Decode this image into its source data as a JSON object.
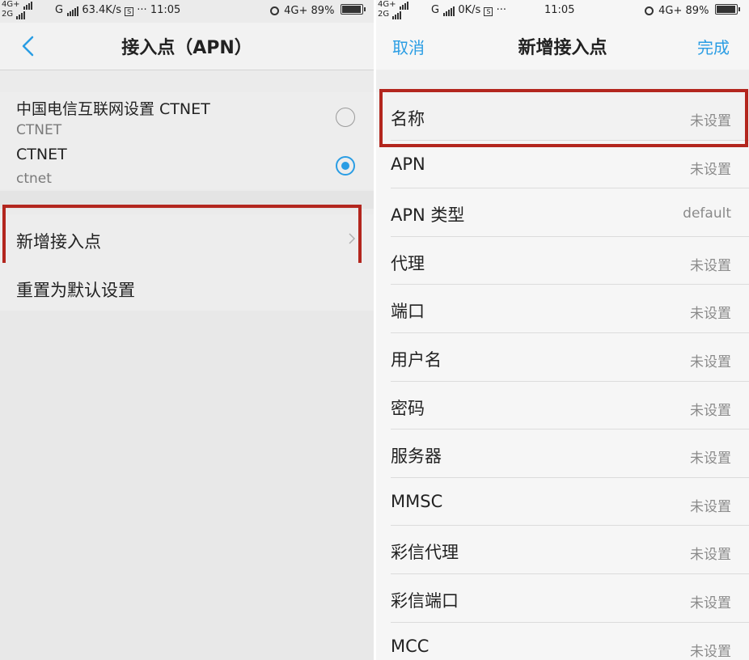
{
  "left": {
    "status": {
      "net_top": "4G+",
      "net_bottom": "2G",
      "carrier2": "G",
      "speed": "63.4K/s",
      "s_box": "S",
      "dots": "···",
      "time": "11:05",
      "net_right": "4G+",
      "battery": "89%"
    },
    "title": "接入点（APN）",
    "apns": [
      {
        "name": "中国电信互联网设置 CTNET",
        "sub": "CTNET",
        "selected": false
      },
      {
        "name": "CTNET",
        "sub": "ctnet",
        "selected": true
      }
    ],
    "add_apn": "新增接入点",
    "reset": "重置为默认设置"
  },
  "right": {
    "status": {
      "net_top": "4G+",
      "net_bottom": "2G",
      "carrier2": "G",
      "speed": "0K/s",
      "s_box": "S",
      "dots": "···",
      "time": "11:05",
      "net_right": "4G+",
      "battery": "89%"
    },
    "cancel": "取消",
    "title": "新增接入点",
    "done": "完成",
    "fields": [
      {
        "label": "名称",
        "value": "未设置"
      },
      {
        "label": "APN",
        "value": "未设置"
      },
      {
        "label": "APN 类型",
        "value": "default"
      },
      {
        "label": "代理",
        "value": "未设置"
      },
      {
        "label": "端口",
        "value": "未设置"
      },
      {
        "label": "用户名",
        "value": "未设置"
      },
      {
        "label": "密码",
        "value": "未设置"
      },
      {
        "label": "服务器",
        "value": "未设置"
      },
      {
        "label": "MMSC",
        "value": "未设置"
      },
      {
        "label": "彩信代理",
        "value": "未设置"
      },
      {
        "label": "彩信端口",
        "value": "未设置"
      },
      {
        "label": "MCC",
        "value": "未设置"
      }
    ]
  },
  "colors": {
    "accent": "#2a9de4",
    "highlight": "#b3261e"
  }
}
